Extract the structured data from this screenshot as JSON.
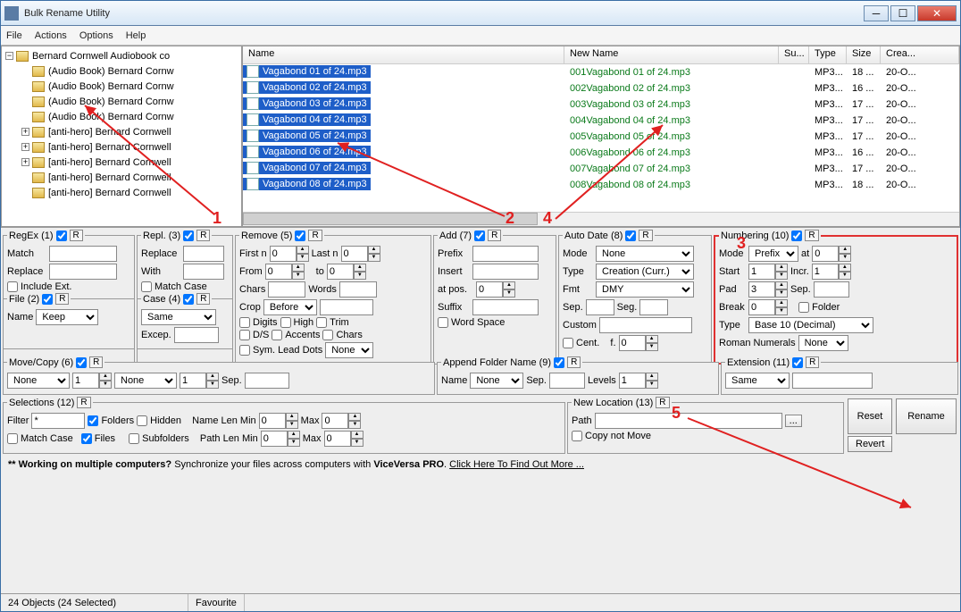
{
  "title": "Bulk Rename Utility",
  "menu": {
    "file": "File",
    "actions": "Actions",
    "options": "Options",
    "help": "Help"
  },
  "tree": {
    "root": "Bernard Cornwell Audiobook co",
    "items": [
      "(Audio Book) Bernard Cornw",
      "(Audio Book) Bernard Cornw",
      "(Audio Book) Bernard Cornw",
      "(Audio Book) Bernard Cornw",
      "[anti-hero] Bernard Cornwell",
      "[anti-hero] Bernard Cornwell",
      "[anti-hero] Bernard Cornwell",
      "[anti-hero] Bernard Cornwell",
      "[anti-hero] Bernard Cornwell"
    ]
  },
  "grid": {
    "headers": {
      "name": "Name",
      "newname": "New Name",
      "sub": "Su...",
      "type": "Type",
      "size": "Size",
      "created": "Crea..."
    },
    "rows": [
      {
        "name": "Vagabond 01 of 24.mp3",
        "newname": "001Vagabond 01 of 24.mp3",
        "type": "MP3...",
        "size": "18 ...",
        "created": "20-O..."
      },
      {
        "name": "Vagabond 02 of 24.mp3",
        "newname": "002Vagabond 02 of 24.mp3",
        "type": "MP3...",
        "size": "16 ...",
        "created": "20-O..."
      },
      {
        "name": "Vagabond 03 of 24.mp3",
        "newname": "003Vagabond 03 of 24.mp3",
        "type": "MP3...",
        "size": "17 ...",
        "created": "20-O..."
      },
      {
        "name": "Vagabond 04 of 24.mp3",
        "newname": "004Vagabond 04 of 24.mp3",
        "type": "MP3...",
        "size": "17 ...",
        "created": "20-O..."
      },
      {
        "name": "Vagabond 05 of 24.mp3",
        "newname": "005Vagabond 05 of 24.mp3",
        "type": "MP3...",
        "size": "17 ...",
        "created": "20-O..."
      },
      {
        "name": "Vagabond 06 of 24.mp3",
        "newname": "006Vagabond 06 of 24.mp3",
        "type": "MP3...",
        "size": "16 ...",
        "created": "20-O..."
      },
      {
        "name": "Vagabond 07 of 24.mp3",
        "newname": "007Vagabond 07 of 24.mp3",
        "type": "MP3...",
        "size": "17 ...",
        "created": "20-O..."
      },
      {
        "name": "Vagabond 08 of 24.mp3",
        "newname": "008Vagabond 08 of 24.mp3",
        "type": "MP3...",
        "size": "18 ...",
        "created": "20-O..."
      }
    ]
  },
  "panels": {
    "regex": {
      "title": "RegEx (1)",
      "match": "Match",
      "replace": "Replace",
      "include_ext": "Include Ext."
    },
    "repl": {
      "title": "Repl. (3)",
      "replace": "Replace",
      "with": "With",
      "match_case": "Match Case"
    },
    "file": {
      "title": "File (2)",
      "name": "Name",
      "value": "Keep"
    },
    "case": {
      "title": "Case (4)",
      "value": "Same",
      "excep": "Excep."
    },
    "remove": {
      "title": "Remove (5)",
      "firstn": "First n",
      "firstn_v": "0",
      "lastn": "Last n",
      "lastn_v": "0",
      "from": "From",
      "from_v": "0",
      "to": "to",
      "to_v": "0",
      "chars": "Chars",
      "words": "Words",
      "crop": "Crop",
      "crop_v": "Before",
      "digits": "Digits",
      "high": "High",
      "trim": "Trim",
      "ds": "D/S",
      "accents": "Accents",
      "chars2": "Chars",
      "sym": "Sym.",
      "leaddots": "Lead Dots",
      "leaddots_v": "None"
    },
    "add": {
      "title": "Add (7)",
      "prefix": "Prefix",
      "insert": "Insert",
      "atpos": "at pos.",
      "atpos_v": "0",
      "suffix": "Suffix",
      "wordspace": "Word Space"
    },
    "autodate": {
      "title": "Auto Date (8)",
      "mode": "Mode",
      "mode_v": "None",
      "type": "Type",
      "type_v": "Creation (Curr.)",
      "fmt": "Fmt",
      "fmt_v": "DMY",
      "sep": "Sep.",
      "seg": "Seg.",
      "custom": "Custom",
      "cent": "Cent.",
      "off": "f.",
      "off_v": "0"
    },
    "numbering": {
      "title": "Numbering (10)",
      "mode": "Mode",
      "mode_v": "Prefix",
      "at": "at",
      "at_v": "0",
      "start": "Start",
      "start_v": "1",
      "incr": "Incr.",
      "incr_v": "1",
      "pad": "Pad",
      "pad_v": "3",
      "sep": "Sep.",
      "break": "Break",
      "break_v": "0",
      "folder": "Folder",
      "type": "Type",
      "type_v": "Base 10 (Decimal)",
      "roman": "Roman Numerals",
      "roman_v": "None"
    },
    "movecopy": {
      "title": "Move/Copy (6)",
      "v1": "None",
      "v2": "1",
      "v3": "None",
      "v4": "1",
      "sep": "Sep."
    },
    "append": {
      "title": "Append Folder Name (9)",
      "name": "Name",
      "name_v": "None",
      "sep": "Sep.",
      "levels": "Levels",
      "levels_v": "1"
    },
    "extension": {
      "title": "Extension (11)",
      "v": "Same"
    },
    "selections": {
      "title": "Selections (12)",
      "filter": "Filter",
      "filter_v": "*",
      "matchcase": "Match Case",
      "folders": "Folders",
      "files": "Files",
      "hidden": "Hidden",
      "subfolders": "Subfolders",
      "namelenmin": "Name Len Min",
      "pathlenmin": "Path Len Min",
      "min_v": "0",
      "max": "Max",
      "max_v": "0"
    },
    "newloc": {
      "title": "New Location (13)",
      "path": "Path",
      "copy": "Copy not Move"
    }
  },
  "buttons": {
    "reset": "Reset",
    "revert": "Revert",
    "rename": "Rename"
  },
  "promo": {
    "p1": "** Working on multiple computers?",
    "p2": " Synchronize your files across computers with ",
    "p3": "ViceVersa PRO",
    "p4": ". ",
    "p5": "Click Here To Find Out More ..."
  },
  "status": {
    "objects": "24 Objects (24 Selected)",
    "favourite": "Favourite"
  },
  "annotations": {
    "a1": "1",
    "a2": "2",
    "a3": "3",
    "a4": "4",
    "a5": "5"
  }
}
